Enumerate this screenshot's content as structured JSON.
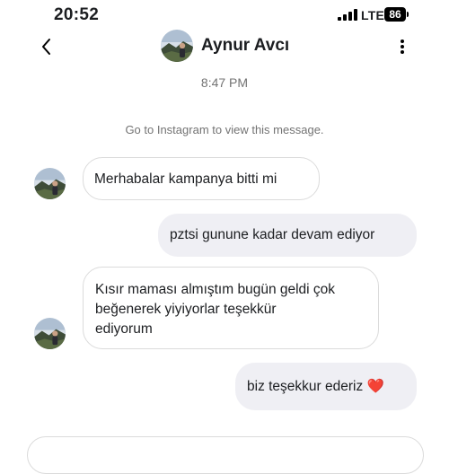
{
  "status_bar": {
    "time": "20:52",
    "network": "LTE",
    "battery": "86"
  },
  "header": {
    "contact_name": "Aynur Avcı",
    "back_icon": "chevron-left-icon",
    "menu_icon": "more-vertical-icon"
  },
  "conversation": {
    "timestamp": "8:47 PM",
    "notice": "Go to Instagram to view this message.",
    "messages": [
      {
        "direction": "received",
        "text": "Merhabalar kampanya bitti mi"
      },
      {
        "direction": "sent",
        "text": "pztsi gunune kadar devam ediyor"
      },
      {
        "direction": "received",
        "lines": [
          "Kısır maması almıştım bugün geldi çok",
          "beğenerek yiyiyorlar teşekkür",
          "ediyorum"
        ]
      },
      {
        "direction": "sent",
        "text": "biz teşekkur ederiz ❤️"
      }
    ]
  },
  "colors": {
    "sent_bubble": "#efeff4",
    "received_border": "#dbdbdb",
    "muted_text": "#737373"
  }
}
